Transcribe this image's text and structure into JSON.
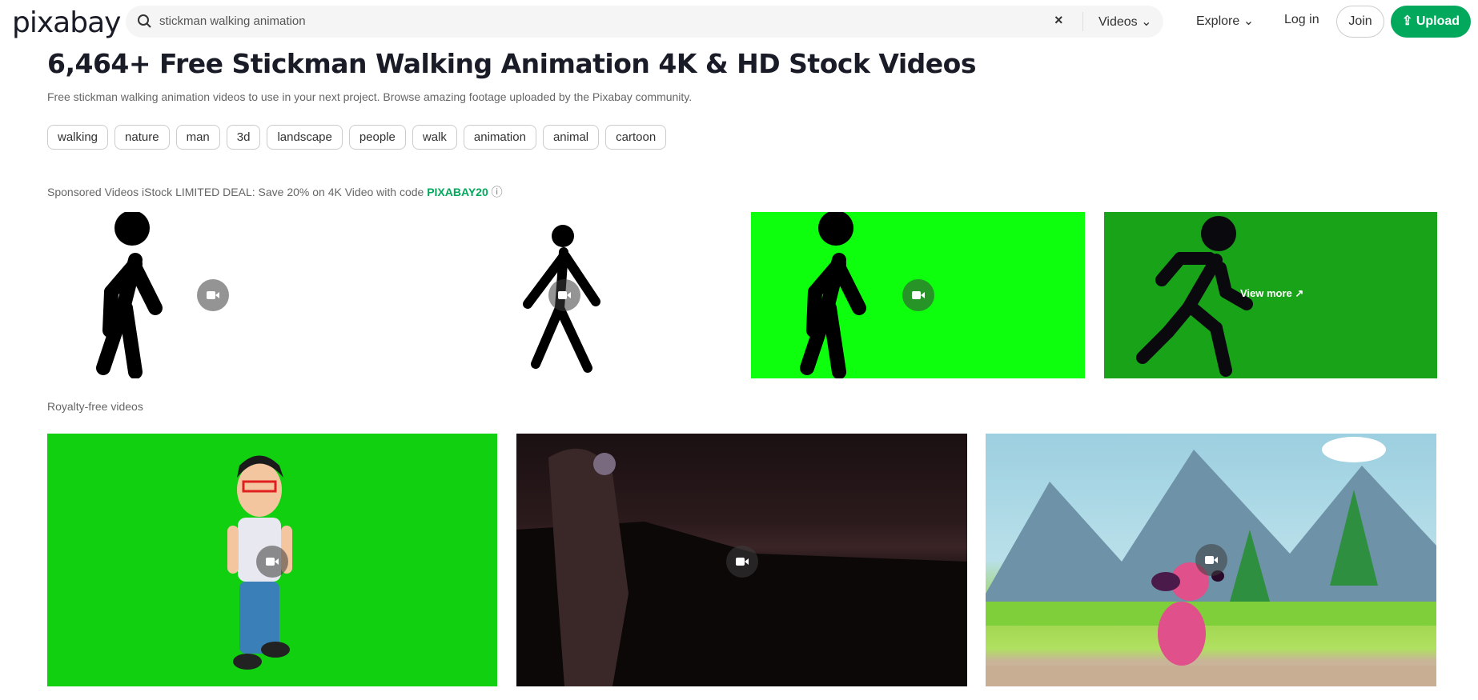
{
  "header": {
    "logo": "pixabay",
    "search_value": "stickman walking animation",
    "search_type": "Videos",
    "explore": "Explore",
    "login": "Log in",
    "join": "Join",
    "upload": "Upload",
    "clear_icon": "×"
  },
  "page": {
    "title": "6,464+ Free Stickman Walking Animation 4K & HD Stock Videos",
    "subtitle": "Free stickman walking animation videos to use in your next project. Browse amazing footage uploaded by the Pixabay community."
  },
  "tags": [
    "walking",
    "nature",
    "man",
    "3d",
    "landscape",
    "people",
    "walk",
    "animation",
    "animal",
    "cartoon"
  ],
  "sponsored": {
    "text": "Sponsored Videos iStock LIMITED DEAL: Save 20% on 4K Video with code ",
    "code": "PIXABAY20",
    "view_more": "View more"
  },
  "royalty_label": "Royalty-free videos",
  "colors": {
    "accent": "#02a95c",
    "chroma_green": "#0dff0d",
    "dark_green": "#19a319"
  }
}
